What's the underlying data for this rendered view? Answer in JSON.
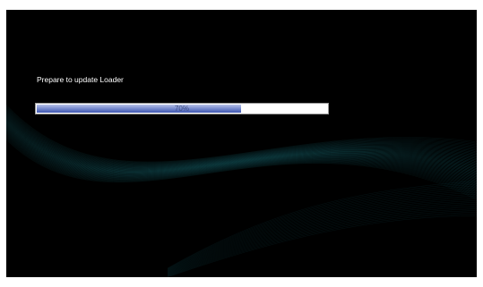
{
  "loader": {
    "status_text": "Prepare to update Loader",
    "progress": {
      "percent": 70,
      "label": "70%"
    }
  },
  "colors": {
    "background": "#000000",
    "wave": "#1f8a96",
    "bar_fill": "#5a70c6",
    "bar_track": "#ffffff",
    "text": "#ffffff"
  }
}
